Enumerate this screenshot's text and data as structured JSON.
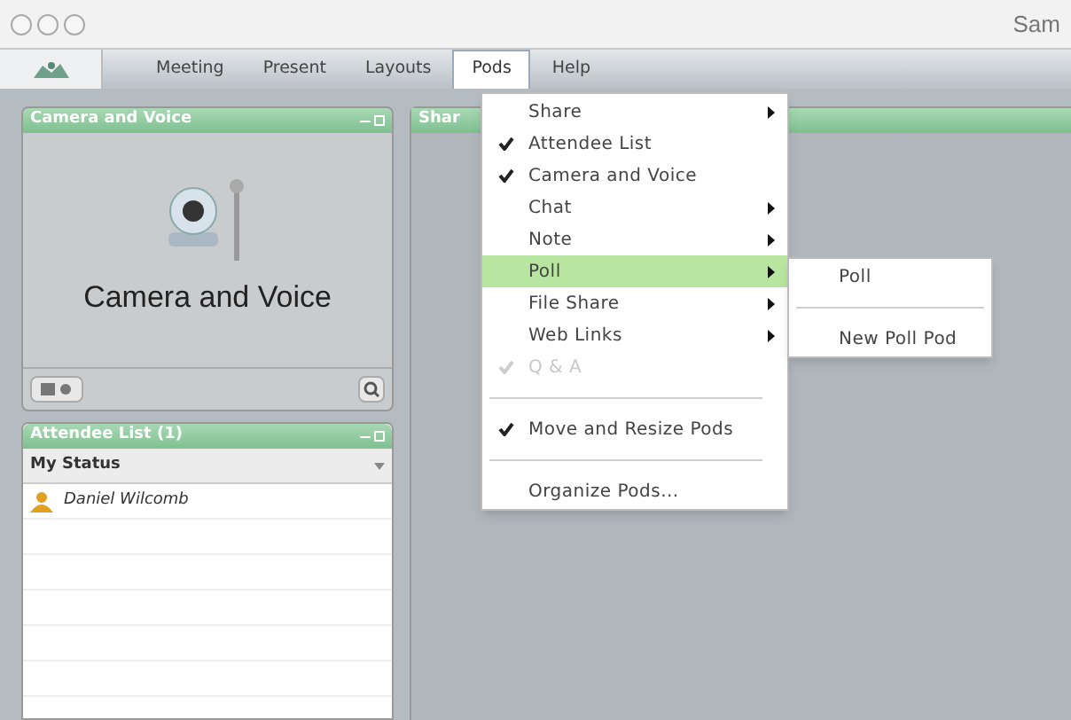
{
  "window": {
    "title": "Sam"
  },
  "menubar": [
    {
      "label": "Meeting",
      "selected": false
    },
    {
      "label": "Present",
      "selected": false
    },
    {
      "label": "Layouts",
      "selected": false
    },
    {
      "label": "Pods",
      "selected": true
    },
    {
      "label": "Help",
      "selected": false
    }
  ],
  "camera_pod": {
    "title": "Camera and Voice",
    "caption": "Camera and Voice"
  },
  "attendee_pod": {
    "title": "Attendee List (1)",
    "status_label": "My Status",
    "attendees": [
      "Daniel Wilcomb"
    ]
  },
  "share_pod": {
    "title": "Shar"
  },
  "pods_menu": [
    {
      "kind": "item",
      "label": "Share",
      "checked": false,
      "submenu": true,
      "disabled": false,
      "selected": false
    },
    {
      "kind": "item",
      "label": "Attendee List",
      "checked": true,
      "submenu": false,
      "disabled": false,
      "selected": false
    },
    {
      "kind": "item",
      "label": "Camera and Voice",
      "checked": true,
      "submenu": false,
      "disabled": false,
      "selected": false
    },
    {
      "kind": "item",
      "label": "Chat",
      "checked": false,
      "submenu": true,
      "disabled": false,
      "selected": false
    },
    {
      "kind": "item",
      "label": "Note",
      "checked": false,
      "submenu": true,
      "disabled": false,
      "selected": false
    },
    {
      "kind": "item",
      "label": "Poll",
      "checked": false,
      "submenu": true,
      "disabled": false,
      "selected": true
    },
    {
      "kind": "item",
      "label": "File Share",
      "checked": false,
      "submenu": true,
      "disabled": false,
      "selected": false
    },
    {
      "kind": "item",
      "label": "Web Links",
      "checked": false,
      "submenu": true,
      "disabled": false,
      "selected": false
    },
    {
      "kind": "item",
      "label": "Q & A",
      "checked": true,
      "submenu": false,
      "disabled": true,
      "selected": false
    },
    {
      "kind": "separator"
    },
    {
      "kind": "item",
      "label": "Move and Resize Pods",
      "checked": true,
      "submenu": false,
      "disabled": false,
      "selected": false
    },
    {
      "kind": "separator"
    },
    {
      "kind": "item",
      "label": "Organize Pods...",
      "checked": false,
      "submenu": false,
      "disabled": false,
      "selected": false
    }
  ],
  "poll_submenu": [
    {
      "kind": "item",
      "label": "Poll"
    },
    {
      "kind": "separator"
    },
    {
      "kind": "item",
      "label": "New Poll Pod"
    }
  ]
}
